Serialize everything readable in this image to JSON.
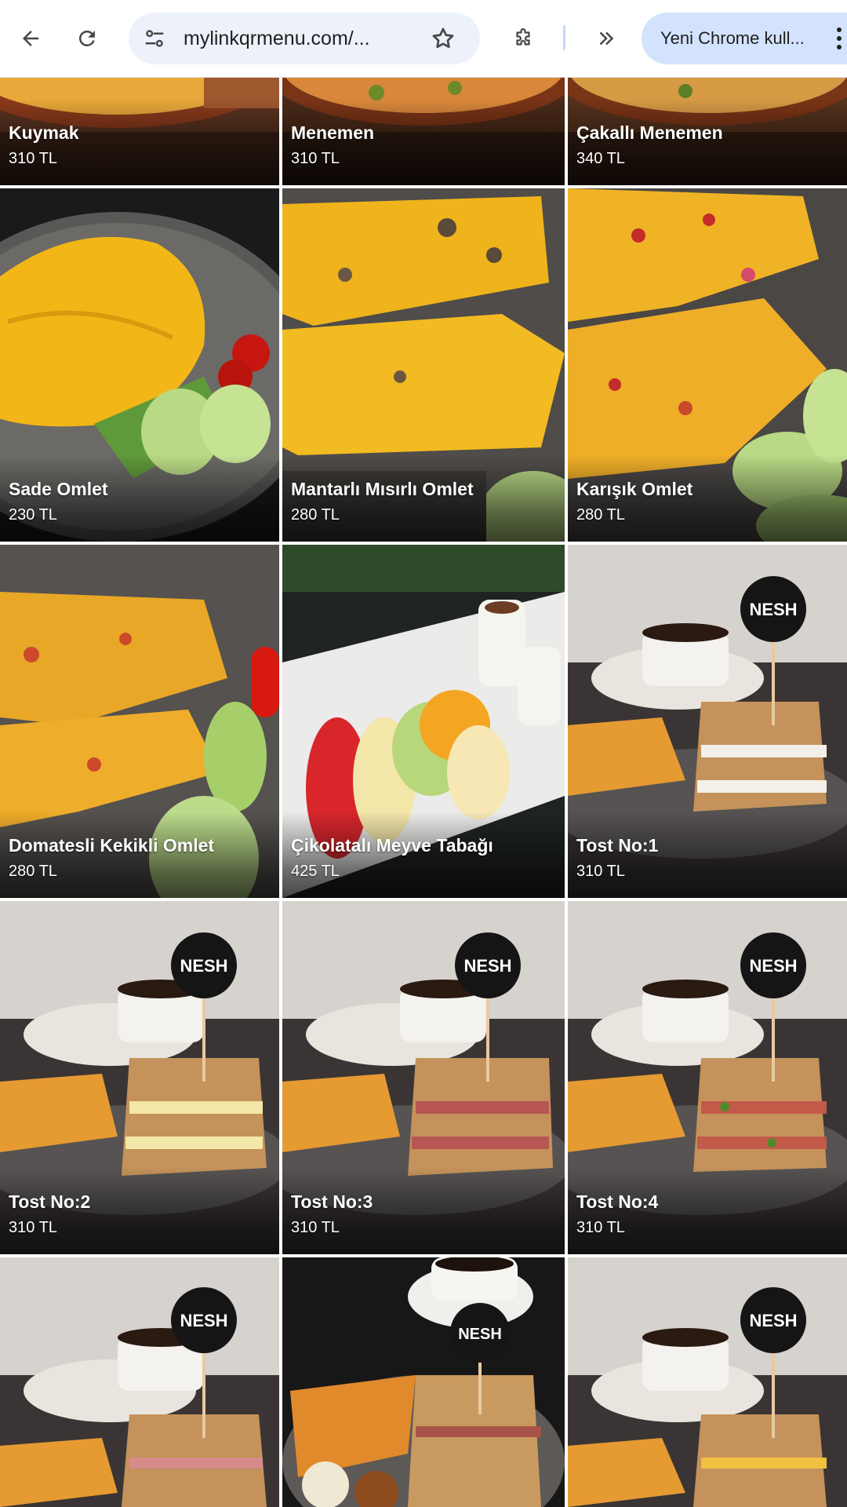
{
  "browser": {
    "url": "mylinkqrmenu.com/...",
    "profile_chip_label": "Yeni Chrome kull...",
    "icons": {
      "back": "arrow-left-icon",
      "reload": "reload-icon",
      "site_info": "tune-icon",
      "bookmark": "star-icon",
      "extensions": "puzzle-icon",
      "overflow": "double-chevron-icon",
      "menu": "kebab-icon"
    }
  },
  "menu": {
    "items": [
      {
        "name": "Kuymak",
        "price": "310 TL"
      },
      {
        "name": "Menemen",
        "price": "310 TL"
      },
      {
        "name": "Çakallı Menemen",
        "price": "340 TL"
      },
      {
        "name": "Sade Omlet",
        "price": "230 TL"
      },
      {
        "name": "Mantarlı Mısırlı Omlet",
        "price": "280 TL"
      },
      {
        "name": "Karışık Omlet",
        "price": "280 TL"
      },
      {
        "name": "Domatesli Kekikli Omlet",
        "price": "280 TL"
      },
      {
        "name": "Çikolatalı Meyve Tabağı",
        "price": "425 TL"
      },
      {
        "name": "Tost No:1",
        "price": "310 TL"
      },
      {
        "name": "Tost No:2",
        "price": "310 TL"
      },
      {
        "name": "Tost No:3",
        "price": "310 TL"
      },
      {
        "name": "Tost No:4",
        "price": "310 TL"
      },
      {
        "name": "",
        "price": ""
      },
      {
        "name": "",
        "price": ""
      },
      {
        "name": "",
        "price": ""
      }
    ],
    "logo_text": "NESH"
  },
  "colors": {
    "omnibox_bg": "#edf2fa",
    "profile_chip_bg": "#d3e3fd",
    "grid_gap": "#ffffff"
  }
}
